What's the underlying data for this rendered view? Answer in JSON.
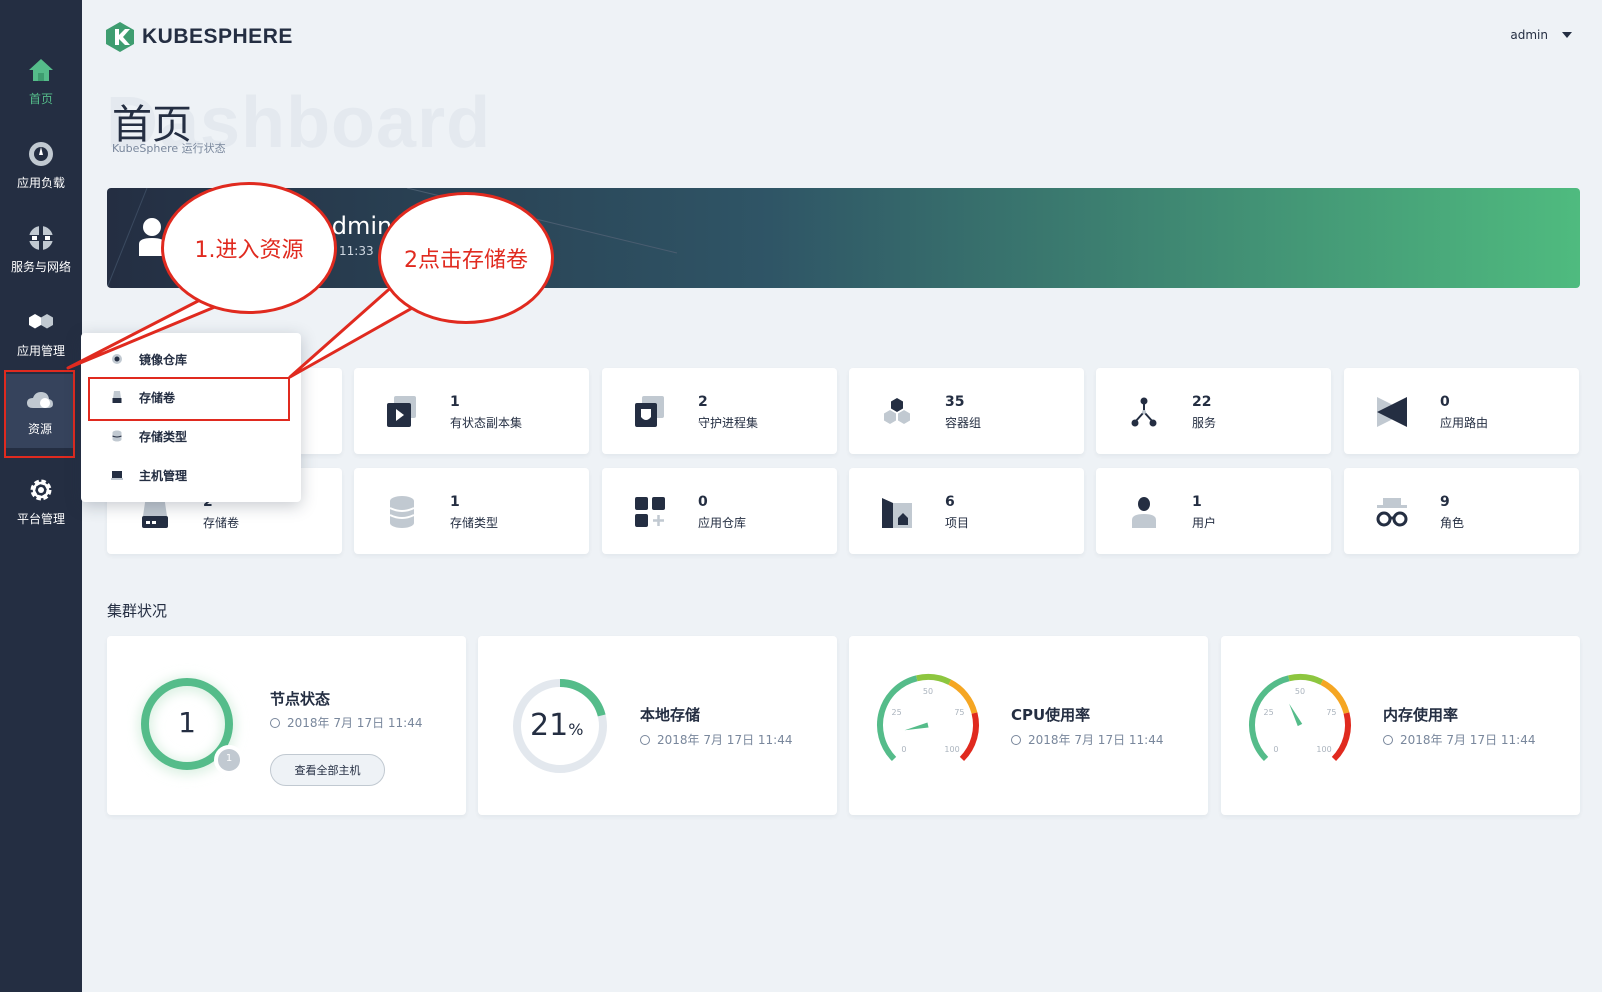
{
  "app": {
    "logo_text": "KUBESPHERE",
    "user": "admin"
  },
  "sidebar": {
    "items": [
      {
        "label": "首页",
        "icon": "home-icon"
      },
      {
        "label": "应用负载",
        "icon": "workload-icon"
      },
      {
        "label": "服务与网络",
        "icon": "network-icon"
      },
      {
        "label": "应用管理",
        "icon": "apps-icon"
      },
      {
        "label": "资源",
        "icon": "cloud-icon"
      },
      {
        "label": "平台管理",
        "icon": "gear-icon"
      }
    ]
  },
  "page": {
    "bg_word": "Dashboard",
    "title": "首页",
    "subtitle": "KubeSphere 运行状态"
  },
  "banner": {
    "name": "admin",
    "time": "11:33"
  },
  "dropdown": {
    "items": [
      {
        "label": "镜像仓库",
        "icon": "registry-icon"
      },
      {
        "label": "存储卷",
        "icon": "volume-icon"
      },
      {
        "label": "存储类型",
        "icon": "storage-class-icon"
      },
      {
        "label": "主机管理",
        "icon": "host-icon"
      }
    ]
  },
  "callouts": {
    "step1": "1.进入资源",
    "step2": "2点击存储卷"
  },
  "stats": [
    {
      "value": "",
      "label": "",
      "icon": "deployment-icon"
    },
    {
      "value": "1",
      "label": "有状态副本集",
      "icon": "statefulset-icon"
    },
    {
      "value": "2",
      "label": "守护进程集",
      "icon": "daemonset-icon"
    },
    {
      "value": "35",
      "label": "容器组",
      "icon": "pod-icon"
    },
    {
      "value": "22",
      "label": "服务",
      "icon": "service-icon"
    },
    {
      "value": "0",
      "label": "应用路由",
      "icon": "ingress-icon"
    },
    {
      "value": "2",
      "label": "存储卷",
      "icon": "volume-icon"
    },
    {
      "value": "1",
      "label": "存储类型",
      "icon": "storage-class-icon"
    },
    {
      "value": "0",
      "label": "应用仓库",
      "icon": "app-repo-icon"
    },
    {
      "value": "6",
      "label": "项目",
      "icon": "project-icon"
    },
    {
      "value": "1",
      "label": "用户",
      "icon": "user-icon"
    },
    {
      "value": "9",
      "label": "角色",
      "icon": "role-icon"
    }
  ],
  "cluster": {
    "title": "集群状况",
    "node": {
      "title": "节点状态",
      "count": "1",
      "badge": "1",
      "time": "2018年 7月 17日 11:44",
      "button": "查看全部主机"
    },
    "storage": {
      "title": "本地存储",
      "value": "21",
      "unit": "%",
      "percent": 21,
      "time": "2018年 7月 17日 11:44"
    },
    "cpu": {
      "title": "CPU使用率",
      "time": "2018年 7月 17日 11:44",
      "ticks": [
        "0",
        "25",
        "50",
        "75",
        "100"
      ],
      "value": 12
    },
    "memory": {
      "title": "内存使用率",
      "time": "2018年 7月 17日 11:44",
      "ticks": [
        "0",
        "25",
        "50",
        "75",
        "100"
      ],
      "value": 40
    }
  },
  "colors": {
    "sidebar": "#242e42",
    "accent": "#55bc8a",
    "annotation": "#e02a1f"
  }
}
